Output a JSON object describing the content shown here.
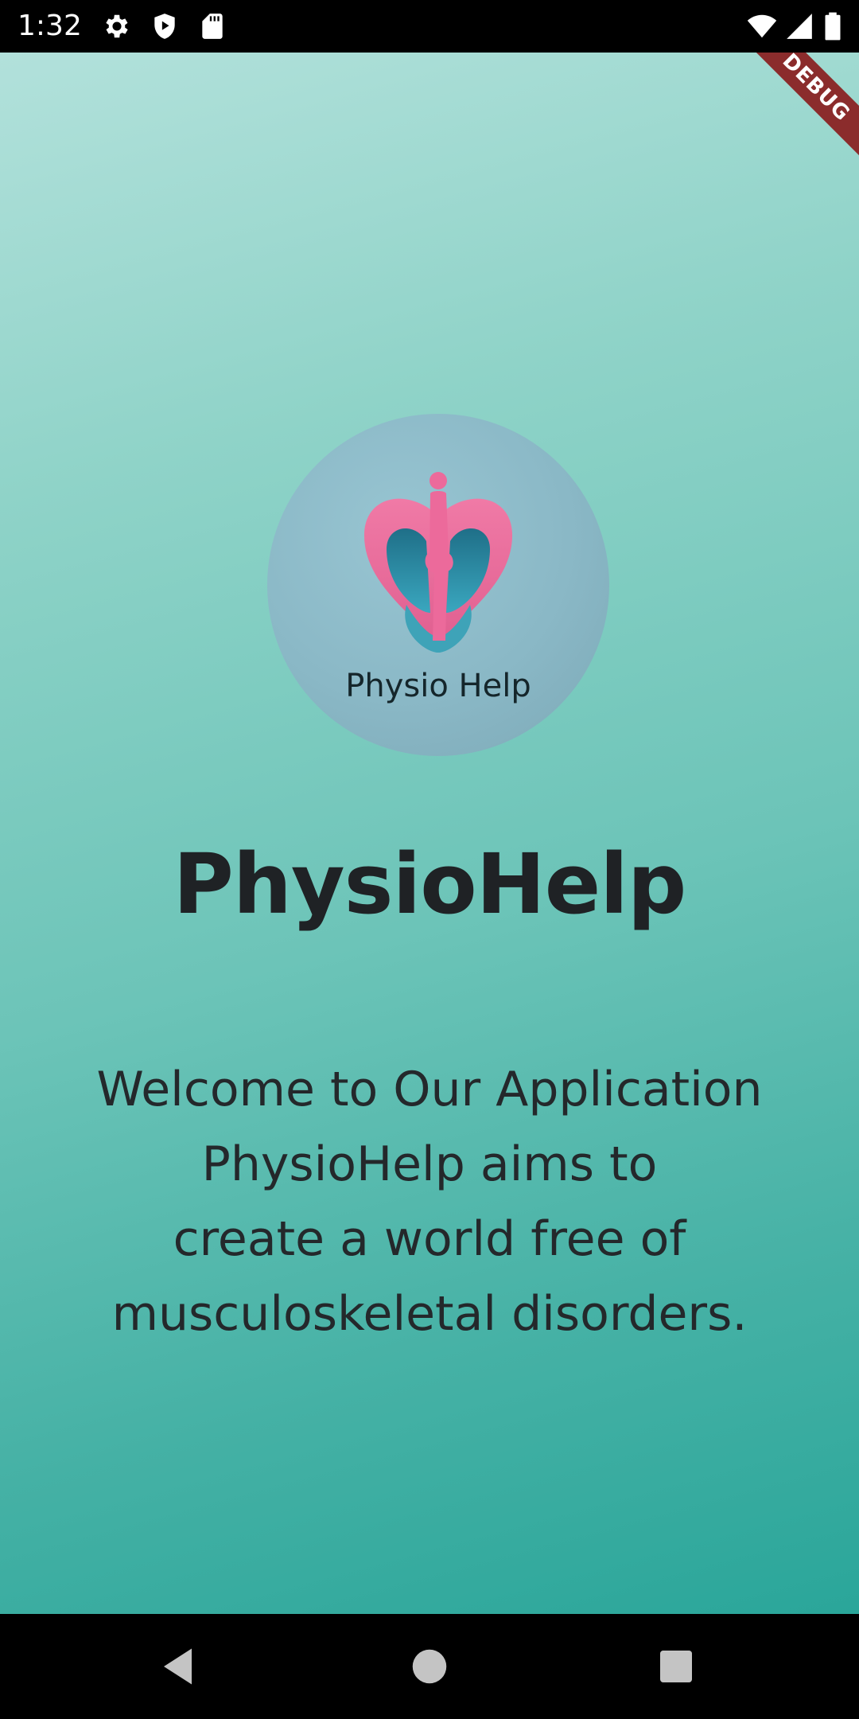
{
  "status_bar": {
    "time": "1:32",
    "left_icons": [
      "settings-icon",
      "shield-play-icon",
      "sd-card-icon"
    ],
    "right_icons": [
      "wifi-icon",
      "signal-icon",
      "battery-icon"
    ]
  },
  "debug_banner": {
    "label": "DEBUG",
    "color": "#8b2c2c"
  },
  "app": {
    "logo_text": "Physio Help",
    "title": "PhysioHelp",
    "welcome_lines": [
      "Welcome to Our Application",
      "PhysioHelp aims to",
      "create a world free of",
      "musculoskeletal disorders."
    ]
  },
  "colors": {
    "gradient_start": "#b2e1db",
    "gradient_end": "#2aa69a",
    "text": "#1f2225",
    "logo_pink": "#ea6e9c",
    "logo_teal": "#2d8ea6"
  },
  "nav_bar": {
    "buttons": [
      "back-icon",
      "home-icon",
      "recents-icon"
    ]
  }
}
